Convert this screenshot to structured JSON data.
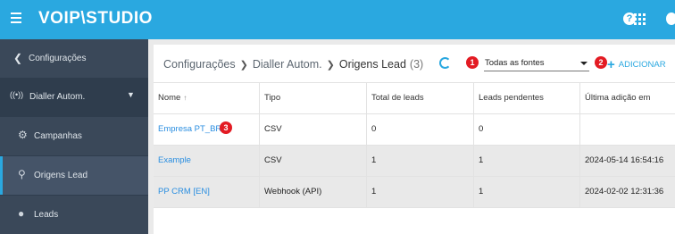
{
  "brand": {
    "logo": "VOIP\\STUDIO",
    "accent": "#2aa8e0",
    "sidebar_bg": "#2f3d4d",
    "badge_color": "#e31b23"
  },
  "sidebar": {
    "back_label": "Configurações",
    "section_label": "Dialler Autom.",
    "items": [
      {
        "label": "Campanhas",
        "icon": "gears-icon"
      },
      {
        "label": "Origens Lead",
        "icon": "source-icon",
        "active": true
      },
      {
        "label": "Leads",
        "icon": "person-icon"
      }
    ]
  },
  "breadcrumb": {
    "first": "Configurações",
    "second": "Dialler Autom.",
    "current": "Origens Lead",
    "count": "(3)"
  },
  "toolbar": {
    "source_filter": "Todas as fontes",
    "add_label": "ADICIONAR"
  },
  "badges": [
    "1",
    "2",
    "3"
  ],
  "table": {
    "headers": [
      "Nome",
      "Tipo",
      "Total de leads",
      "Leads pendentes",
      "Última adição em"
    ],
    "rows": [
      {
        "name": "Empresa PT_BR",
        "type": "CSV",
        "total": "0",
        "pending": "0",
        "last": ""
      },
      {
        "name": "Example",
        "type": "CSV",
        "total": "1",
        "pending": "1",
        "last": "2024-05-14 16:54:16"
      },
      {
        "name": "PP CRM [EN]",
        "type": "Webhook (API)",
        "total": "1",
        "pending": "1",
        "last": "2024-02-02 12:31:36"
      }
    ]
  }
}
